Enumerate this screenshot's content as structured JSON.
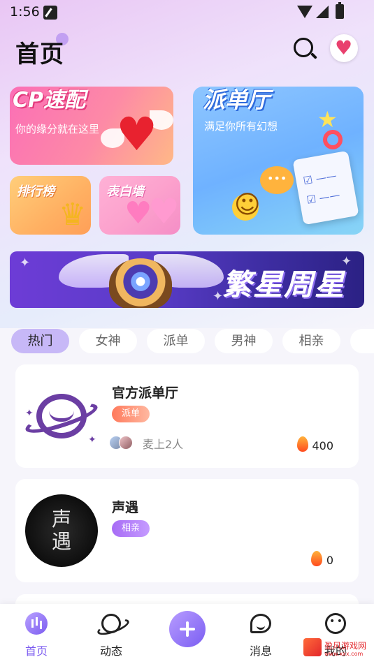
{
  "status_bar": {
    "time": "1:56"
  },
  "header": {
    "title": "首页"
  },
  "feature_cards": {
    "cp": {
      "title": "CP速配",
      "subtitle": "你的缘分就在这里"
    },
    "ranking": {
      "title": "排行榜"
    },
    "confession": {
      "title": "表白墙"
    },
    "dispatch": {
      "title": "派单厅",
      "subtitle": "满足你所有幻想"
    }
  },
  "banner": {
    "text": "繁星周星"
  },
  "tabs": [
    "热门",
    "女神",
    "派单",
    "男神",
    "相亲"
  ],
  "active_tab": "热门",
  "rooms": [
    {
      "name": "官方派单厅",
      "tag": "派单",
      "mic_text": "麦上2人",
      "heat": "400"
    },
    {
      "name": "声遇",
      "tag": "相亲",
      "heat": "0",
      "avatar_text": "声\n遇"
    }
  ],
  "bottom_nav": {
    "home": "首页",
    "moments": "动态",
    "messages": "消息",
    "me": "我的"
  },
  "watermark": {
    "text": "盈风游戏网",
    "url": "www.xxx.com"
  },
  "colors": {
    "accent": "#7c5cf0",
    "tab_active_bg": "#c7b8f7",
    "tag_orange": "#ff7a5c",
    "tag_purple": "#a76cf5"
  }
}
